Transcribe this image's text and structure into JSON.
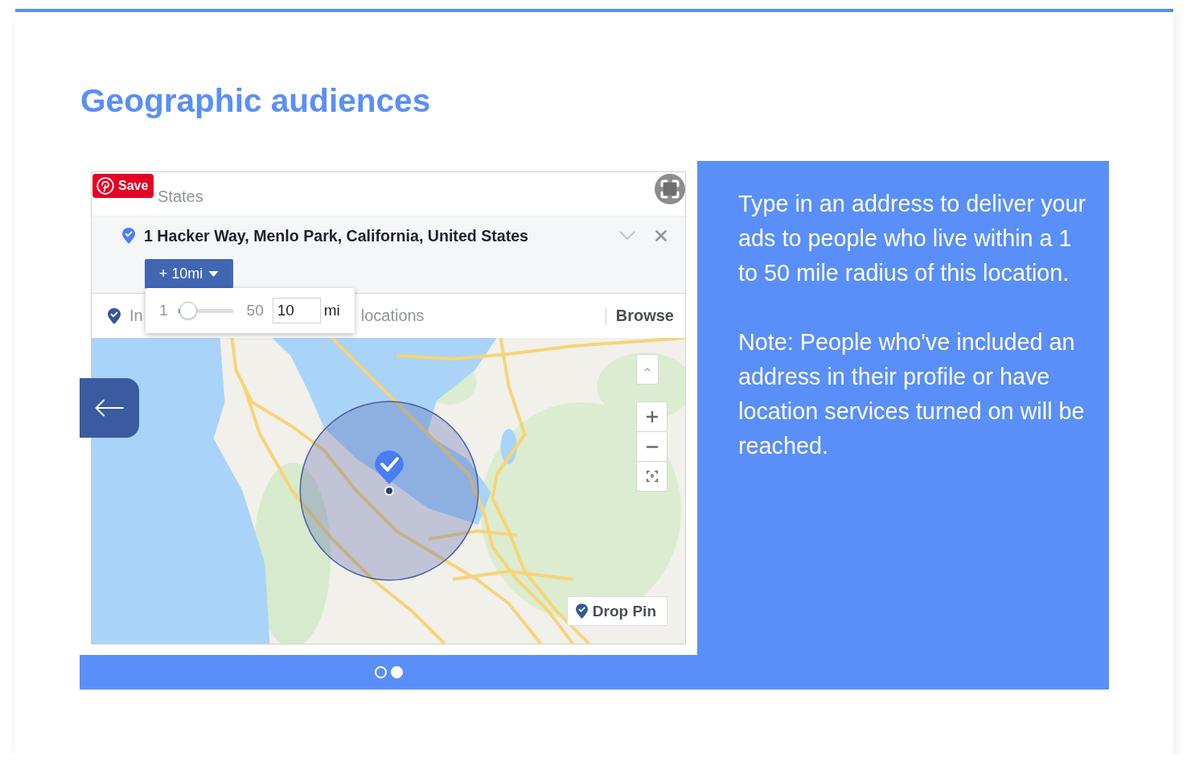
{
  "header": {
    "title": "Geographic audiences"
  },
  "carousel": {
    "screenshot": {
      "save_button": {
        "label": "Save"
      },
      "country_text": "States",
      "location": {
        "address": "1 Hacker Way, Menlo Park, California, United States"
      },
      "radius_button": {
        "label": "+ 10mi"
      },
      "radius_popup": {
        "min_label": "1",
        "level": 0.18,
        "max_label": "50",
        "value": "10",
        "unit": "mi"
      },
      "search": {
        "placeholder_start": "In",
        "placeholder_end": "locations",
        "browse_label": "Browse"
      },
      "map": {
        "drop_pin_label": "Drop Pin"
      }
    },
    "description": [
      "Type in an address to deliver your ads to people who live within a 1 to 50 mile radius of this location.",
      "Note: People who've included an address in their profile or have location services turned on will be reached."
    ],
    "dots": [
      {
        "selected": false
      },
      {
        "selected": true
      }
    ]
  }
}
